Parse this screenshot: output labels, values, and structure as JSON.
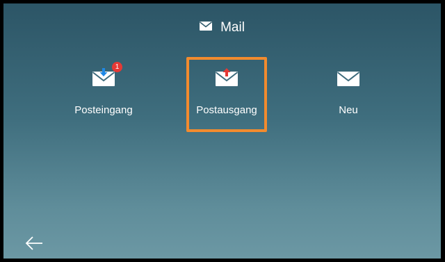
{
  "header": {
    "title": "Mail",
    "icon": "envelope-icon"
  },
  "tiles": [
    {
      "label": "Posteingang",
      "icon": "inbox-envelope-icon",
      "badge": "1",
      "arrow_color": "#1e88e5"
    },
    {
      "label": "Postausgang",
      "icon": "outbox-envelope-icon",
      "selected": true,
      "arrow_color": "#e53935"
    },
    {
      "label": "Neu",
      "icon": "new-envelope-icon"
    }
  ],
  "footer": {
    "back_icon": "back-arrow-icon"
  },
  "colors": {
    "selection_border": "#f28b2e",
    "badge": "#e53935"
  }
}
